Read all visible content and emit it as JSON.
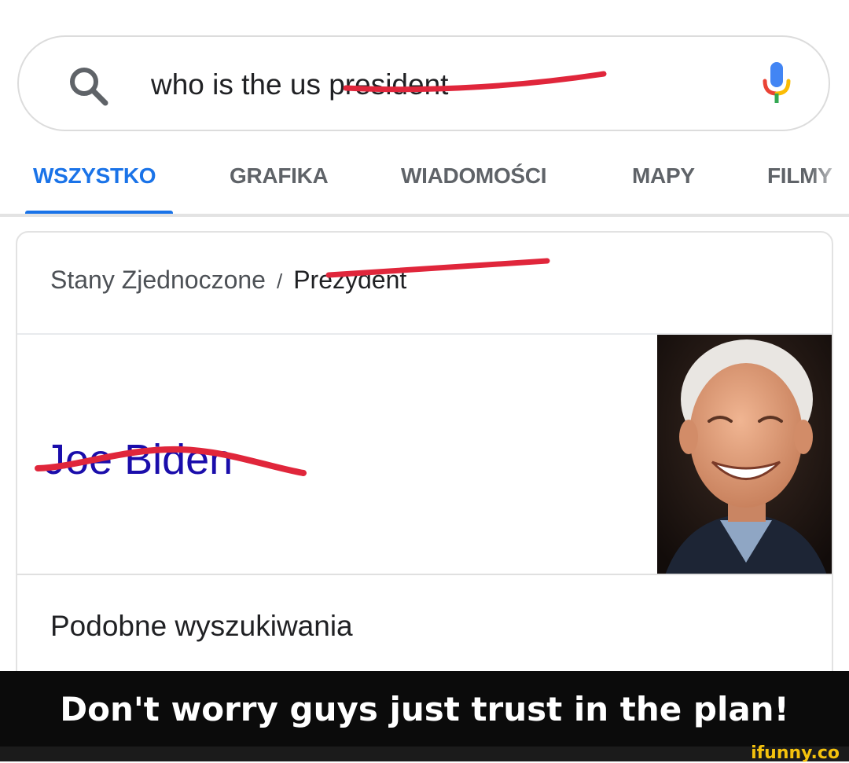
{
  "search": {
    "query": "who is the us president",
    "icons": {
      "search": "search-icon",
      "mic": "mic-icon"
    },
    "colors": {
      "mic_top": "#4285f4",
      "mic_left": "#ea4335",
      "mic_right": "#fbbc05",
      "mic_stem": "#34a853"
    }
  },
  "tabs": [
    {
      "label": "WSZYSTKO",
      "active": true
    },
    {
      "label": "GRAFIKA",
      "active": false
    },
    {
      "label": "WIADOMOŚCI",
      "active": false
    },
    {
      "label": "MAPY",
      "active": false
    },
    {
      "label": "FILMY",
      "active": false
    }
  ],
  "card": {
    "breadcrumb": {
      "parent": "Stany Zjednoczone",
      "separator": "/",
      "current": "Prezydent"
    },
    "entity_name": "Joe Biden",
    "photo_icon": "person-photo",
    "related_heading": "Podobne wyszukiwania"
  },
  "caption": "Don't worry guys just trust in the plan!",
  "watermark": "ifunny.co",
  "colors": {
    "accent": "#1a73e8",
    "strike": "#e0263b",
    "link": "#1a0dab"
  }
}
